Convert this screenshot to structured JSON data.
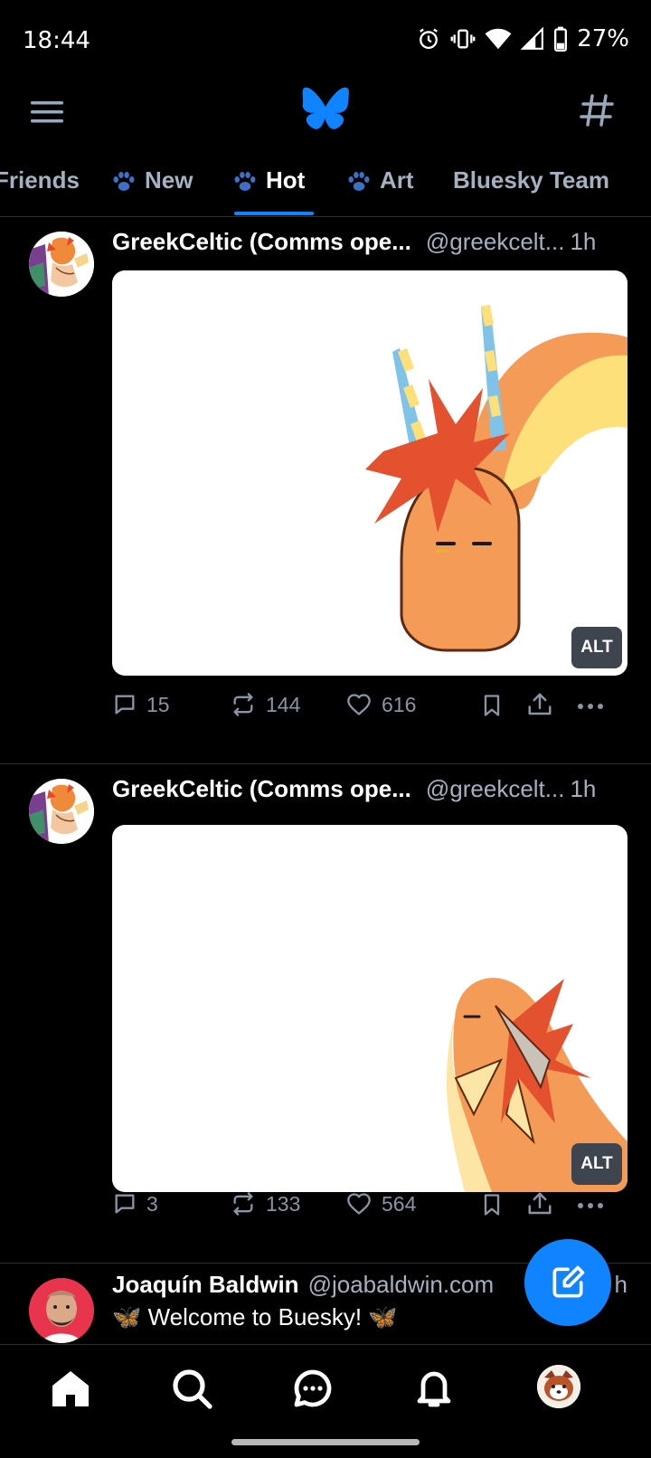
{
  "status_bar": {
    "time": "18:44",
    "battery": "27%",
    "icons": [
      "alarm-icon",
      "vibrate-icon",
      "wifi-icon",
      "cellular-icon",
      "battery-icon"
    ]
  },
  "app_bar": {
    "icons": [
      "menu-icon",
      "bluesky-butterfly-logo",
      "hashtag-icon"
    ]
  },
  "tabs": [
    {
      "label": "Friends",
      "has_paw": false,
      "active": false
    },
    {
      "label": "New",
      "has_paw": true,
      "active": false
    },
    {
      "label": "Hot",
      "has_paw": true,
      "active": true
    },
    {
      "label": "Art",
      "has_paw": true,
      "active": false
    },
    {
      "label": "Bluesky Team",
      "has_paw": false,
      "active": false
    }
  ],
  "posts": [
    {
      "author": "GreekCeltic (Comms ope...",
      "handle": "@greekcelt...",
      "time": "1h",
      "alt": "ALT",
      "replies": "15",
      "reposts": "144",
      "likes": "616"
    },
    {
      "author": "GreekCeltic (Comms ope...",
      "handle": "@greekcelt...",
      "time": "1h",
      "alt": "ALT",
      "replies": "3",
      "reposts": "133",
      "likes": "564"
    },
    {
      "author": "Joaquín Baldwin",
      "handle": "@joabaldwin.com",
      "time": "h",
      "text": "🦋 Welcome to Buesky! 🦋"
    }
  ],
  "colors": {
    "accent": "#1083fe",
    "background": "#000000",
    "muted_text": "#a5b1c0",
    "action_icons": "#8a95a3"
  },
  "bottom_nav": [
    "home-icon",
    "search-icon",
    "chat-icon",
    "notifications-bell-icon",
    "profile-avatar"
  ]
}
